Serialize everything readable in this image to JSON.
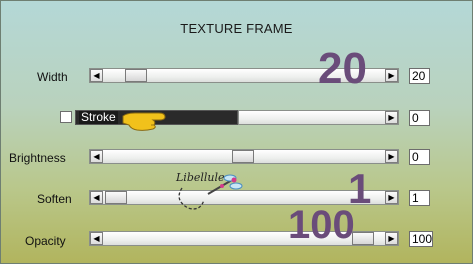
{
  "dialog": {
    "title": "TEXTURE FRAME"
  },
  "rows": [
    {
      "label": "Width",
      "value": "20",
      "overlay": "20",
      "level": 0.12
    },
    {
      "label": "Stroke",
      "value": "0",
      "overlay": "",
      "level": 0
    },
    {
      "label": "Brightness",
      "value": "0",
      "overlay": "",
      "level": 0.5
    },
    {
      "label": "Soften",
      "value": "1",
      "overlay": "1",
      "level": 0.01
    },
    {
      "label": "Opacity",
      "value": "100",
      "overlay": "100",
      "level": 1.0
    }
  ],
  "watermark": {
    "text": "Libellule"
  },
  "icons": {
    "left_arrow": "left-arrow-icon",
    "right_arrow": "right-arrow-icon",
    "hand_pointer": "hand-pointer-icon",
    "dragonfly": "dragonfly-icon"
  },
  "colors": {
    "overlay_numbers": "#6a4c7a",
    "background_top": "#b4d8d7",
    "background_bottom": "#b1b45d"
  }
}
